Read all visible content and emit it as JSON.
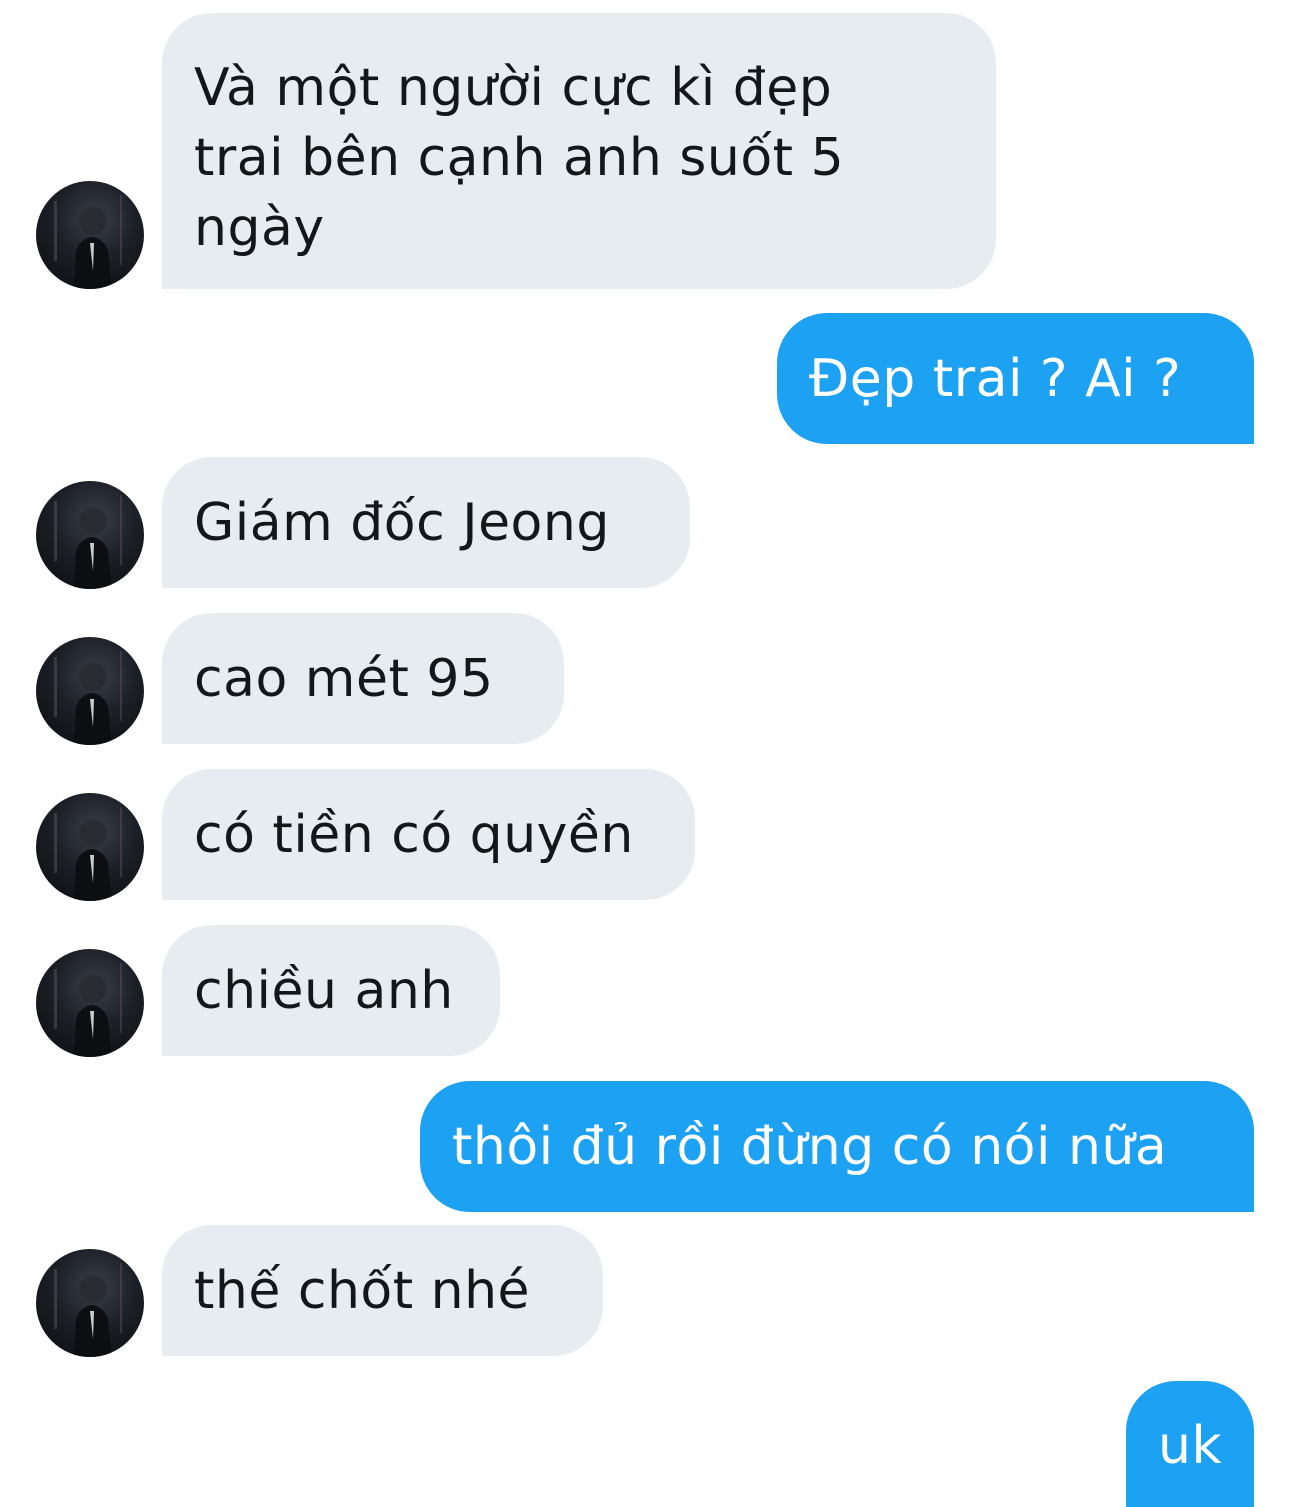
{
  "conversation": {
    "messages": [
      {
        "sender": "them",
        "text": "Và một người cực kì đẹp trai bên cạnh anh suốt 5 ngày"
      },
      {
        "sender": "me",
        "text": "Đẹp trai ? Ai ?"
      },
      {
        "sender": "them",
        "text": "Giám đốc Jeong"
      },
      {
        "sender": "them",
        "text": "cao mét 95"
      },
      {
        "sender": "them",
        "text": "có tiền có quyền"
      },
      {
        "sender": "them",
        "text": "chiều anh"
      },
      {
        "sender": "me",
        "text": "thôi đủ rồi đừng có nói nữa"
      },
      {
        "sender": "them",
        "text": "thế chốt nhé"
      },
      {
        "sender": "me",
        "text": "uk"
      }
    ]
  },
  "colors": {
    "incoming_bubble": "#e6ecf0",
    "incoming_text": "#14171a",
    "outgoing_bubble": "#1da1f2",
    "outgoing_text": "#ffffff"
  },
  "icons": {
    "avatar": "user-avatar-photo"
  }
}
